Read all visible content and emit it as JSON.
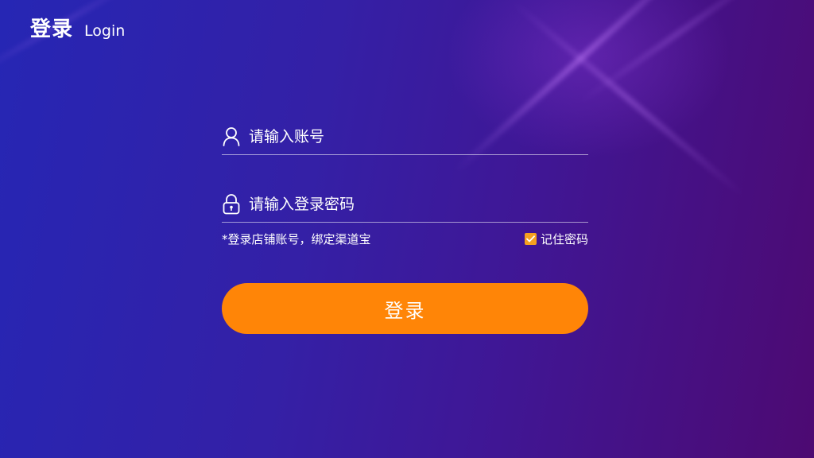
{
  "header": {
    "title_cn": "登录",
    "title_en": "Login"
  },
  "form": {
    "account": {
      "placeholder": "请输入账号",
      "value": "",
      "icon": "user-icon"
    },
    "password": {
      "placeholder": "请输入登录密码",
      "value": "",
      "icon": "lock-icon"
    },
    "hint": "*登录店铺账号，绑定渠道宝",
    "remember": {
      "label": "记住密码",
      "checked": true,
      "icon": "checkmark-icon"
    }
  },
  "login_button": {
    "label": "登录"
  },
  "colors": {
    "accent": "#ff8507",
    "checkbox": "#f5a01f",
    "background_start": "#2626b4",
    "background_end": "#4d0a72",
    "text": "#ffffff"
  }
}
